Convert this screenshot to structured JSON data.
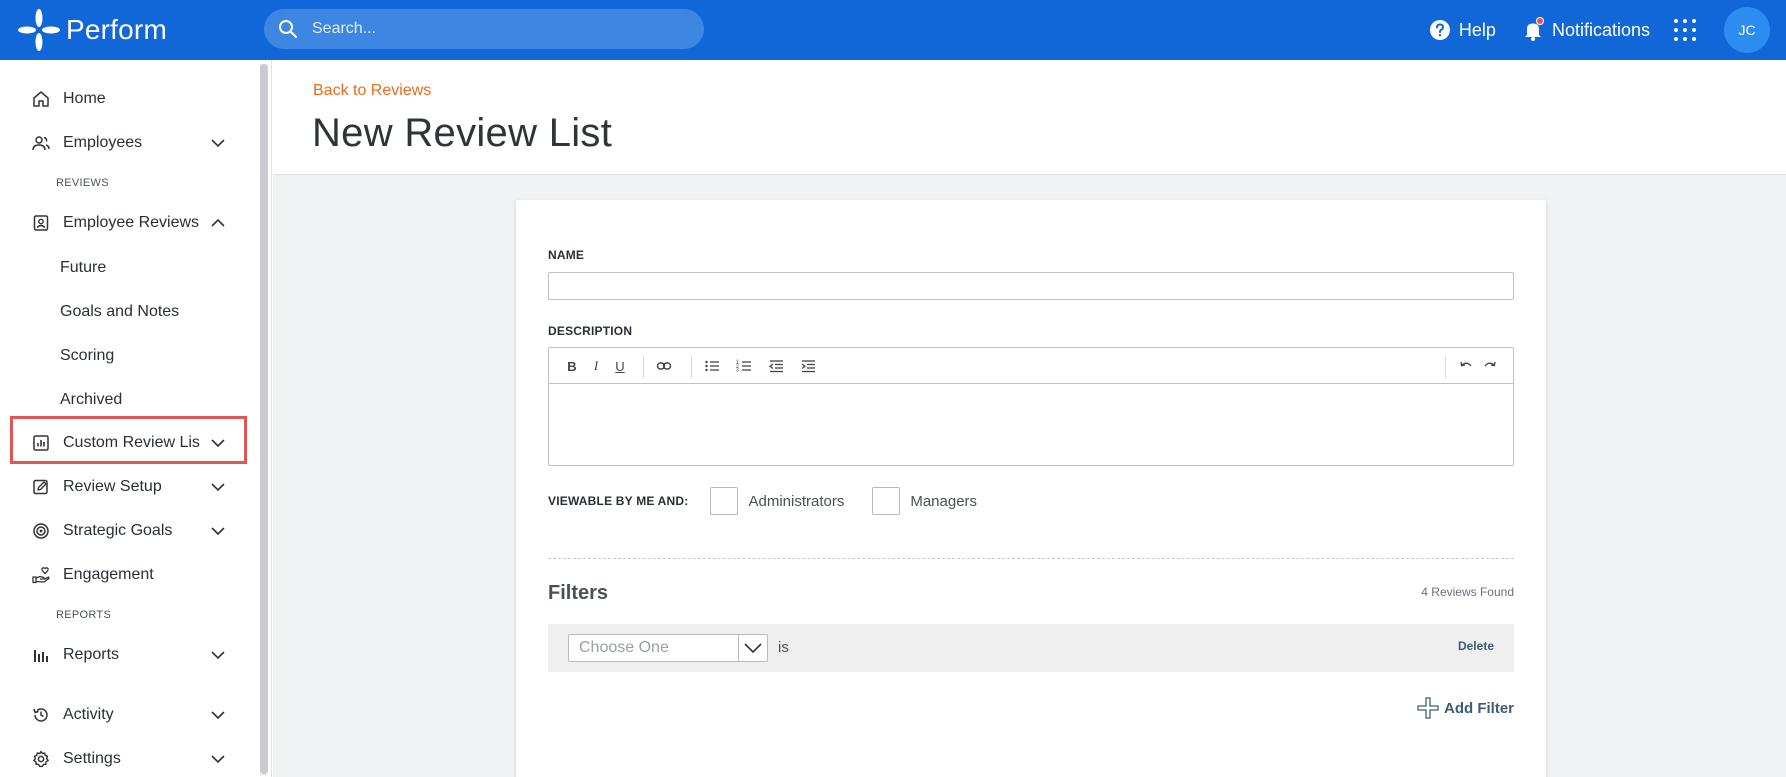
{
  "app": {
    "name": "Perform",
    "colors": {
      "brand": "#1167d8",
      "accent": "#ea6a1d",
      "highlight": "#e25555"
    }
  },
  "topbar": {
    "search_placeholder": "Search...",
    "help_label": "Help",
    "notifications_label": "Notifications",
    "avatar_initials": "JC"
  },
  "sidebar": {
    "home": "Home",
    "employees": "Employees",
    "section_reviews": "REVIEWS",
    "employee_reviews": "Employee Reviews",
    "sub_future": "Future",
    "sub_goals": "Goals and Notes",
    "sub_scoring": "Scoring",
    "sub_archived": "Archived",
    "custom_review_lists": "Custom Review Lis",
    "review_setup": "Review Setup",
    "strategic_goals": "Strategic Goals",
    "engagement": "Engagement",
    "section_reports": "REPORTS",
    "reports": "Reports",
    "activity": "Activity",
    "settings": "Settings"
  },
  "main": {
    "back_link": "Back to Reviews",
    "title": "New Review List"
  },
  "form": {
    "name_label": "NAME",
    "name_value": "",
    "description_label": "DESCRIPTION",
    "viewable_label": "VIEWABLE BY ME AND:",
    "administrators": "Administrators",
    "administrators_checked": false,
    "managers": "Managers",
    "managers_checked": false,
    "toolbar_icons": [
      "bold-icon",
      "italic-icon",
      "underline-icon",
      "link-icon",
      "bullet-list-icon",
      "numbered-list-icon",
      "outdent-icon",
      "indent-icon",
      "undo-icon",
      "redo-icon"
    ],
    "bold": "B",
    "italic": "I",
    "underline": "U"
  },
  "filters": {
    "title": "Filters",
    "found": "4 Reviews Found",
    "select_value": "Choose One",
    "operator": "is",
    "delete": "Delete",
    "add_filter": "Add Filter"
  }
}
